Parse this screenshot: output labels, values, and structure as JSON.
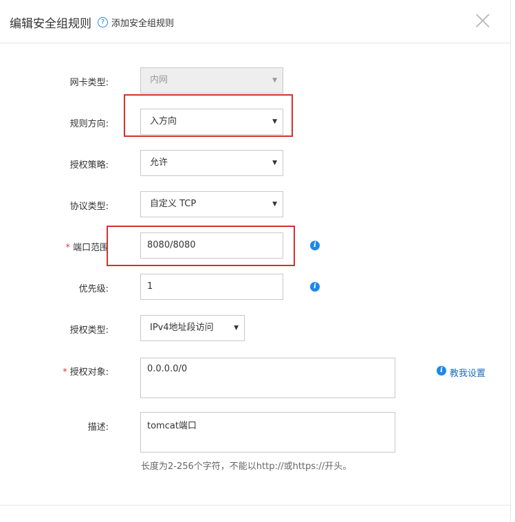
{
  "header": {
    "title": "编辑安全组规则",
    "help_link": "添加安全组规则"
  },
  "form": {
    "nic_type": {
      "label": "网卡类型:",
      "value": "内网"
    },
    "direction": {
      "label": "规则方向:",
      "value": "入方向"
    },
    "policy": {
      "label": "授权策略:",
      "value": "允许"
    },
    "protocol": {
      "label": "协议类型:",
      "value": "自定义 TCP"
    },
    "port_range": {
      "label": "端口范围",
      "value": "8080/8080",
      "required": true
    },
    "priority": {
      "label": "优先级:",
      "value": "1"
    },
    "auth_type": {
      "label": "授权类型:",
      "value": "IPv4地址段访问"
    },
    "auth_object": {
      "label": "授权对象:",
      "value": "0.0.0.0/0",
      "required": true,
      "help_link": "教我设置"
    },
    "description": {
      "label": "描述:",
      "value": "tomcat端口",
      "hint": "长度为2-256个字符，不能以http://或https://开头。"
    }
  },
  "icons": {
    "required_mark": "*",
    "help": "?",
    "info": "i",
    "dropdown_arrow": "▼"
  },
  "colors": {
    "accent": "#1e88e5",
    "annotation_red": "#d32f2f",
    "required_red": "#e53935"
  }
}
